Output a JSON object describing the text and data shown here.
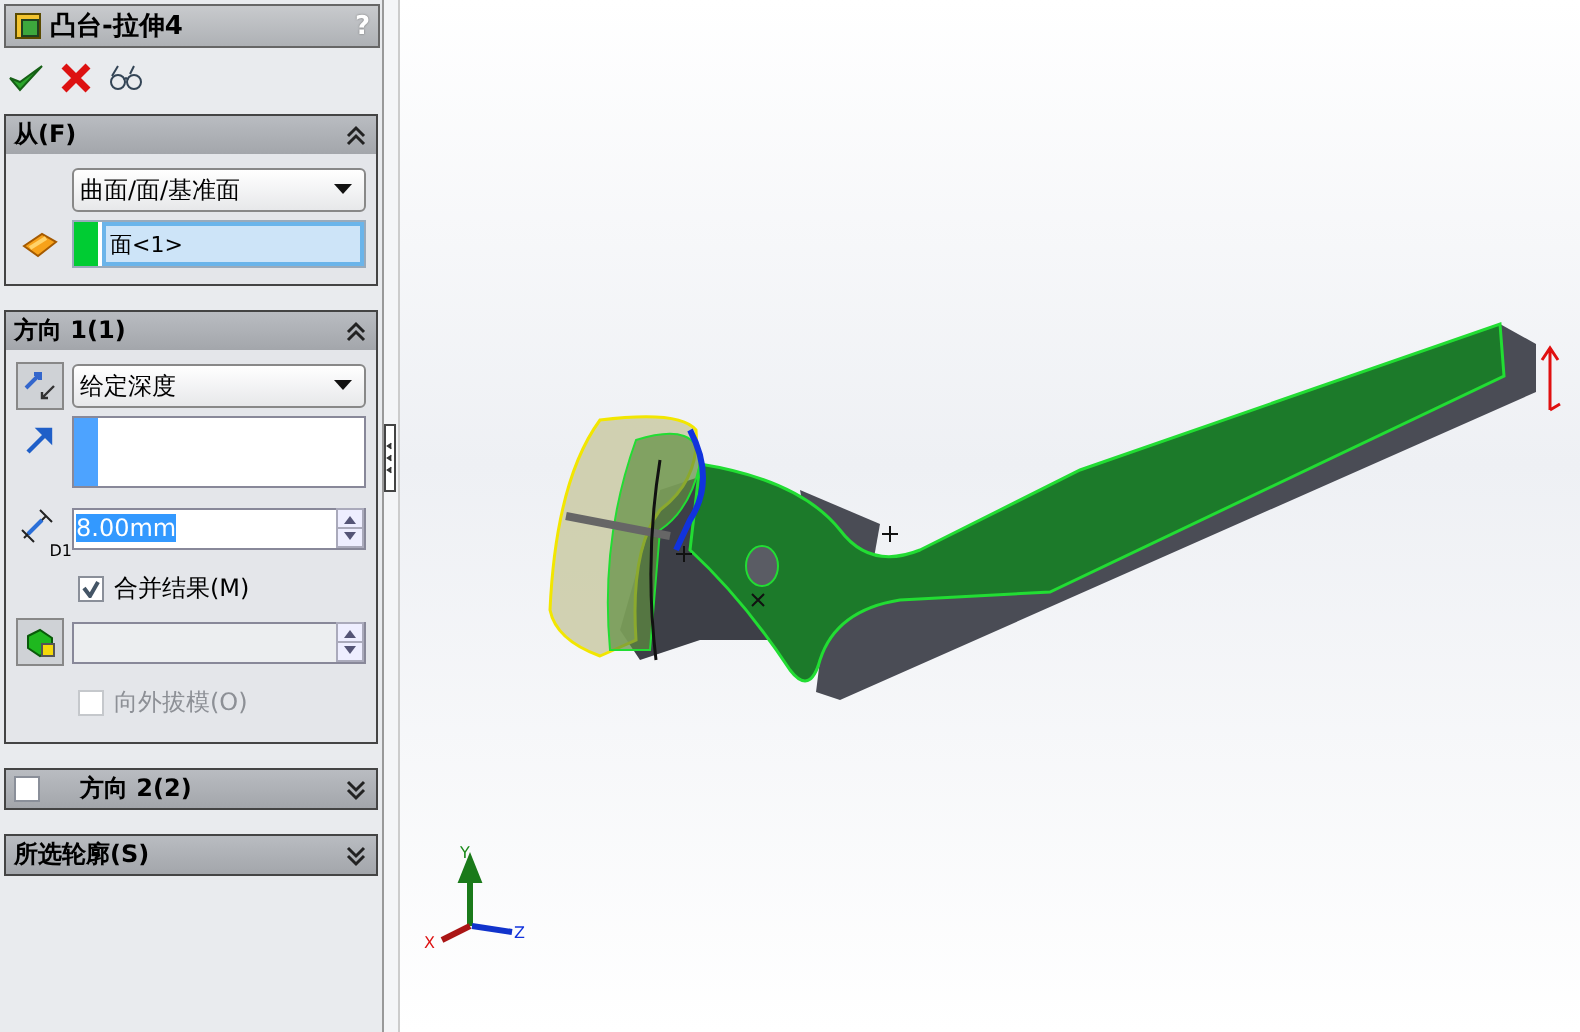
{
  "title": "凸台-拉伸4",
  "help": "?",
  "sections": [
    {
      "kind": "from",
      "label": "从(F)",
      "expanded": true,
      "dropdown": "曲面/面/基准面",
      "selection": "面<1>"
    },
    {
      "kind": "direction",
      "label": "方向 1(1)",
      "expanded": true,
      "dropdown": "给定深度",
      "depth": "8.00mm",
      "dimension_label": "D1",
      "options": [
        {
          "label": "合并结果(M)",
          "checked": true,
          "disabled": false
        },
        {
          "label": "向外拔模(O)",
          "checked": false,
          "disabled": true
        }
      ]
    },
    {
      "kind": "collapsed",
      "label": "方向 2(2)",
      "expanded": false,
      "checked": false
    },
    {
      "kind": "collapsed",
      "label": "所选轮廓(S)",
      "expanded": false
    }
  ],
  "triad": {
    "x": "X",
    "y": "Y",
    "z": "Z"
  }
}
